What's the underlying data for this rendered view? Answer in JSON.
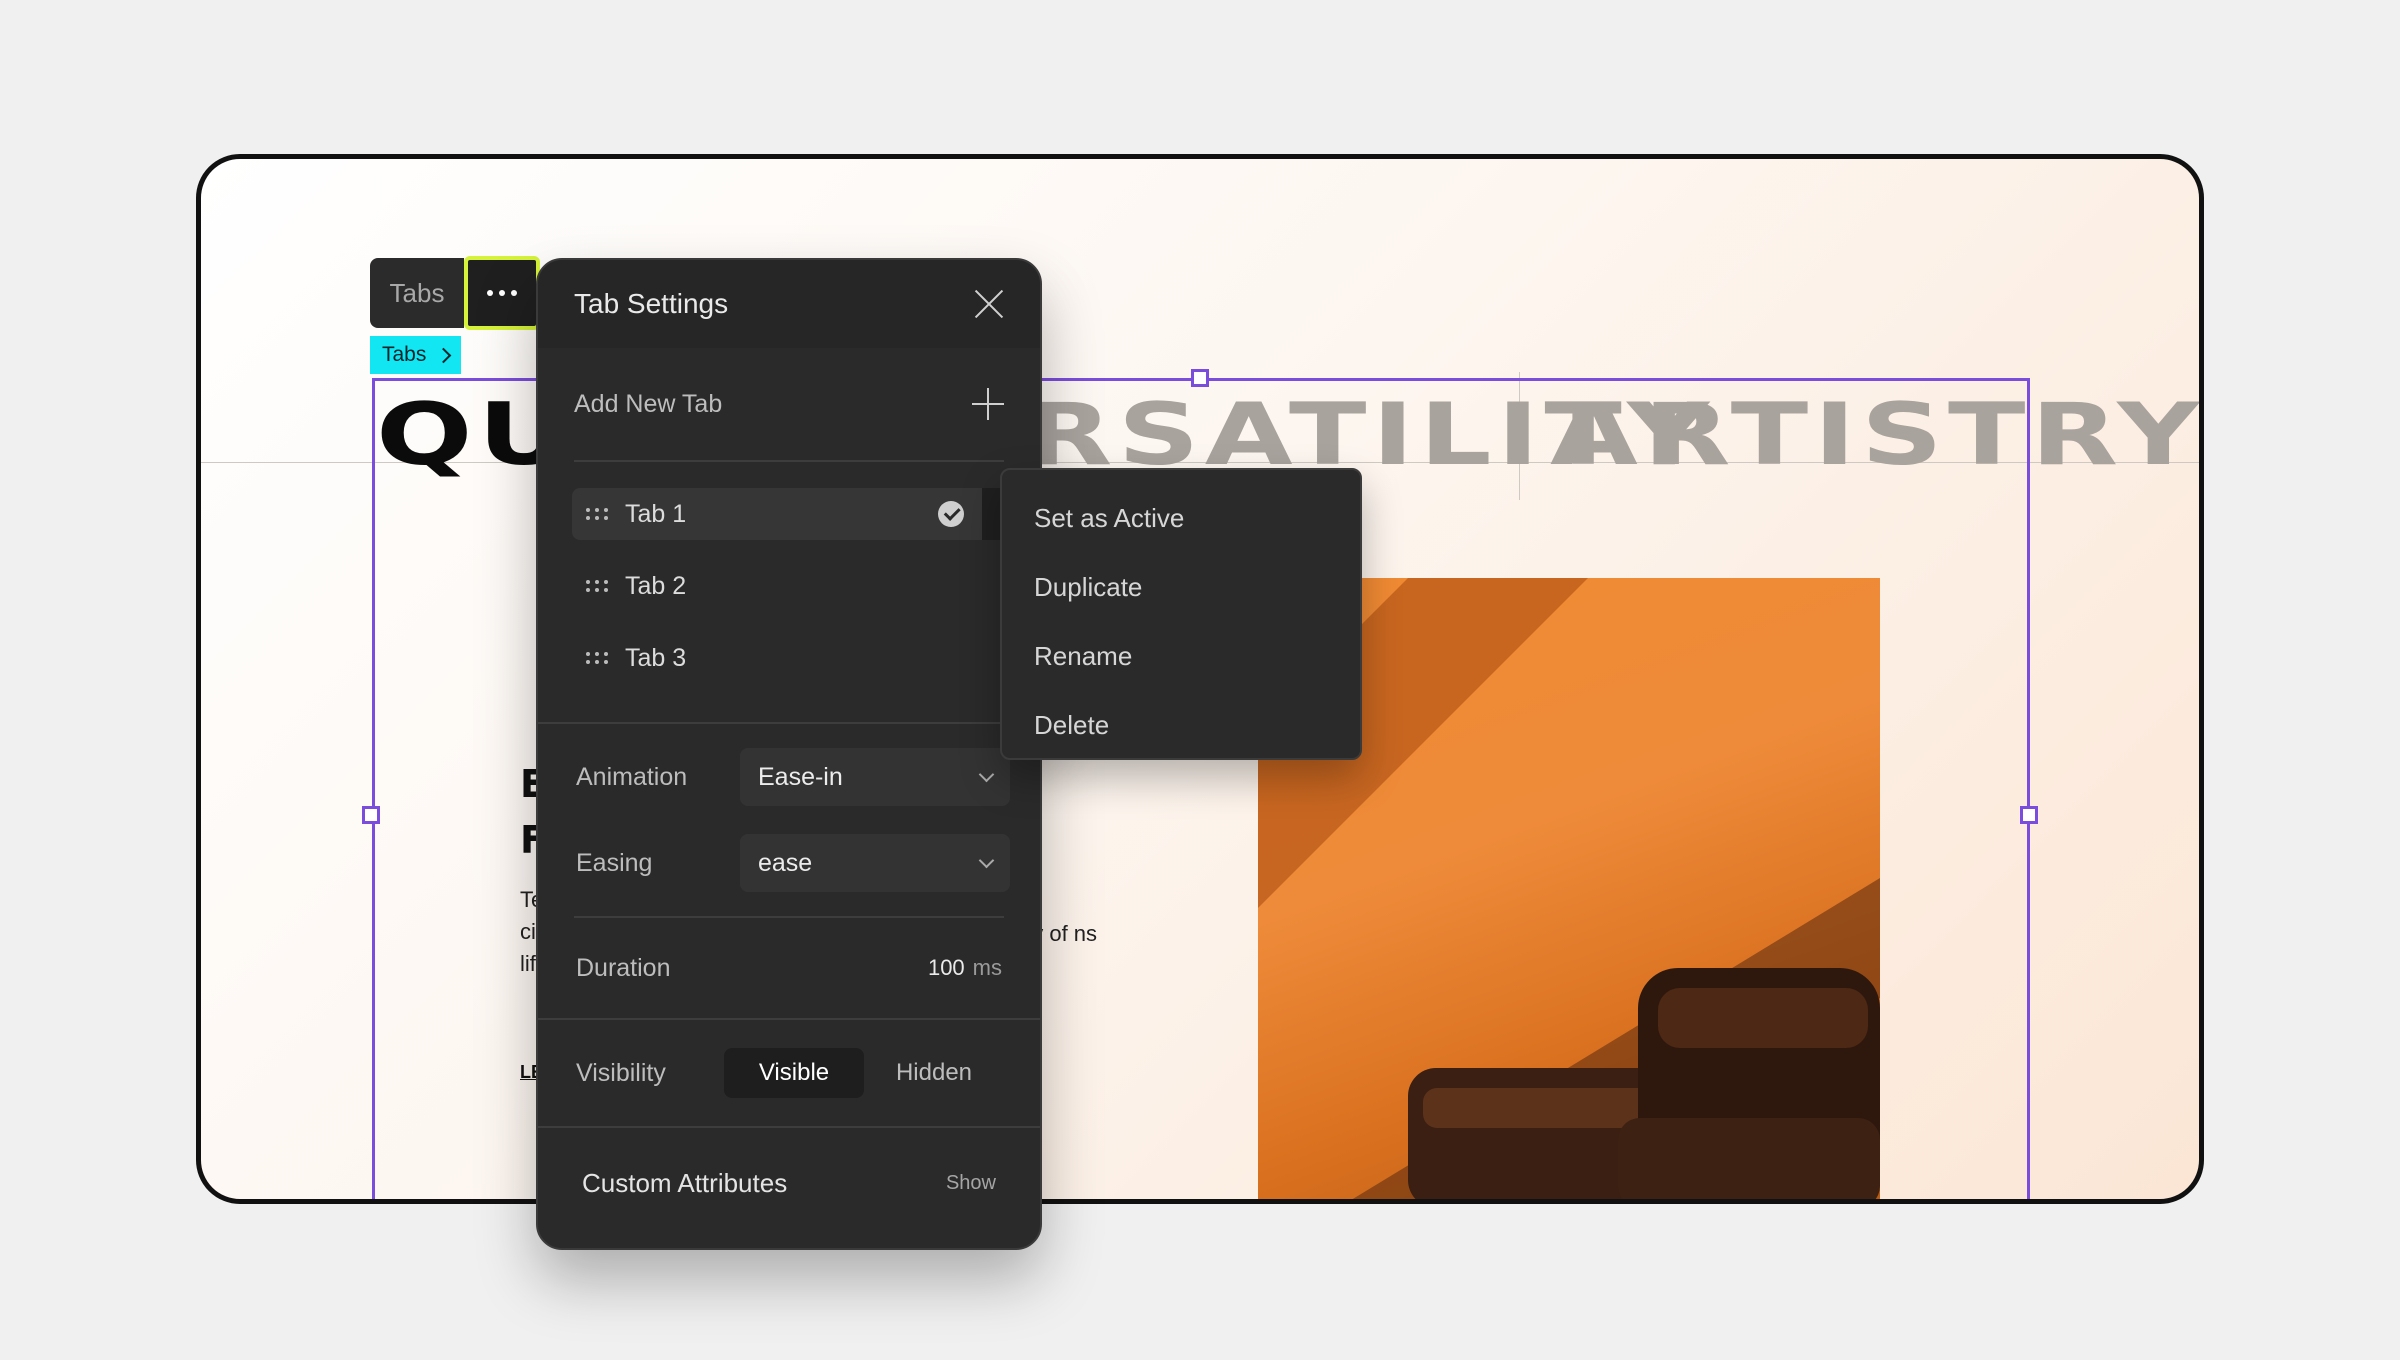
{
  "canvas": {
    "hero_words": [
      "QUA",
      "RSATILITY",
      "ARTISTRY"
    ],
    "partial_headings": [
      "E",
      "F"
    ],
    "partial_body_left": "Te ci in lif",
    "partial_body_right": "ny of ns to",
    "partial_link": "LE"
  },
  "element_toolbar": {
    "element_label": "Tabs",
    "more_icon": "ellipsis-icon",
    "breadcrumb_label": "Tabs"
  },
  "panel": {
    "title": "Tab Settings",
    "add_tab_label": "Add New Tab",
    "tabs": [
      {
        "label": "Tab 1",
        "active": true
      },
      {
        "label": "Tab 2",
        "active": false
      },
      {
        "label": "Tab 3",
        "active": false
      }
    ],
    "animation": {
      "label": "Animation",
      "value": "Ease-in"
    },
    "easing": {
      "label": "Easing",
      "value": "ease"
    },
    "duration": {
      "label": "Duration",
      "value": "100",
      "unit": "ms"
    },
    "visibility": {
      "label": "Visibility",
      "options": [
        "Visible",
        "Hidden"
      ],
      "selected": "Visible"
    },
    "custom_attributes": {
      "label": "Custom Attributes",
      "action": "Show"
    }
  },
  "context_menu": {
    "items": [
      "Set as Active",
      "Duplicate",
      "Rename",
      "Delete"
    ]
  },
  "colors": {
    "selection": "#7b4ddc",
    "highlight_border": "#d7f23a",
    "breadcrumb_bg": "#12e6f2",
    "panel_bg": "#2a2a2a",
    "photo_orange": "#f08a32"
  }
}
